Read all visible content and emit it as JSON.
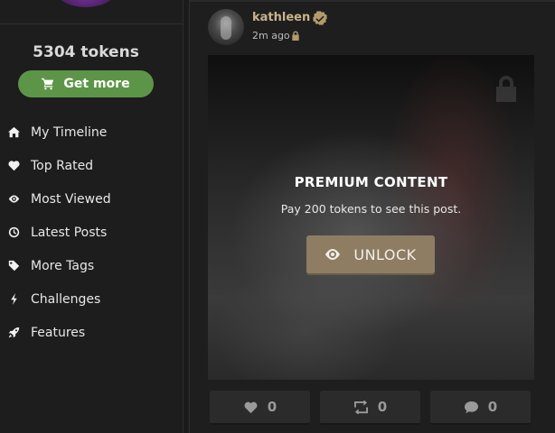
{
  "sidebar": {
    "tokens_label": "5304 tokens",
    "get_more_label": "Get more",
    "get_more_icon": "cart-icon",
    "items": [
      {
        "label": "My Timeline",
        "icon": "home-icon"
      },
      {
        "label": "Top Rated",
        "icon": "heart-icon"
      },
      {
        "label": "Most Viewed",
        "icon": "eye-icon"
      },
      {
        "label": "Latest Posts",
        "icon": "clock-icon"
      },
      {
        "label": "More Tags",
        "icon": "tag-icon"
      },
      {
        "label": "Challenges",
        "icon": "bolt-icon"
      },
      {
        "label": "Features",
        "icon": "rocket-icon"
      }
    ]
  },
  "post": {
    "username": "kathleen",
    "verified": true,
    "time": "2m ago",
    "premium_title": "PREMIUM CONTENT",
    "premium_subtitle": "Pay 200 tokens to see this post.",
    "unlock_label": "UNLOCK",
    "likes": "0",
    "reposts": "0",
    "comments": "0"
  },
  "colors": {
    "accent_green": "#5d9548",
    "unlock_bg": "#8e7d63",
    "username": "#c8b48c",
    "background": "#1b1b1b"
  }
}
